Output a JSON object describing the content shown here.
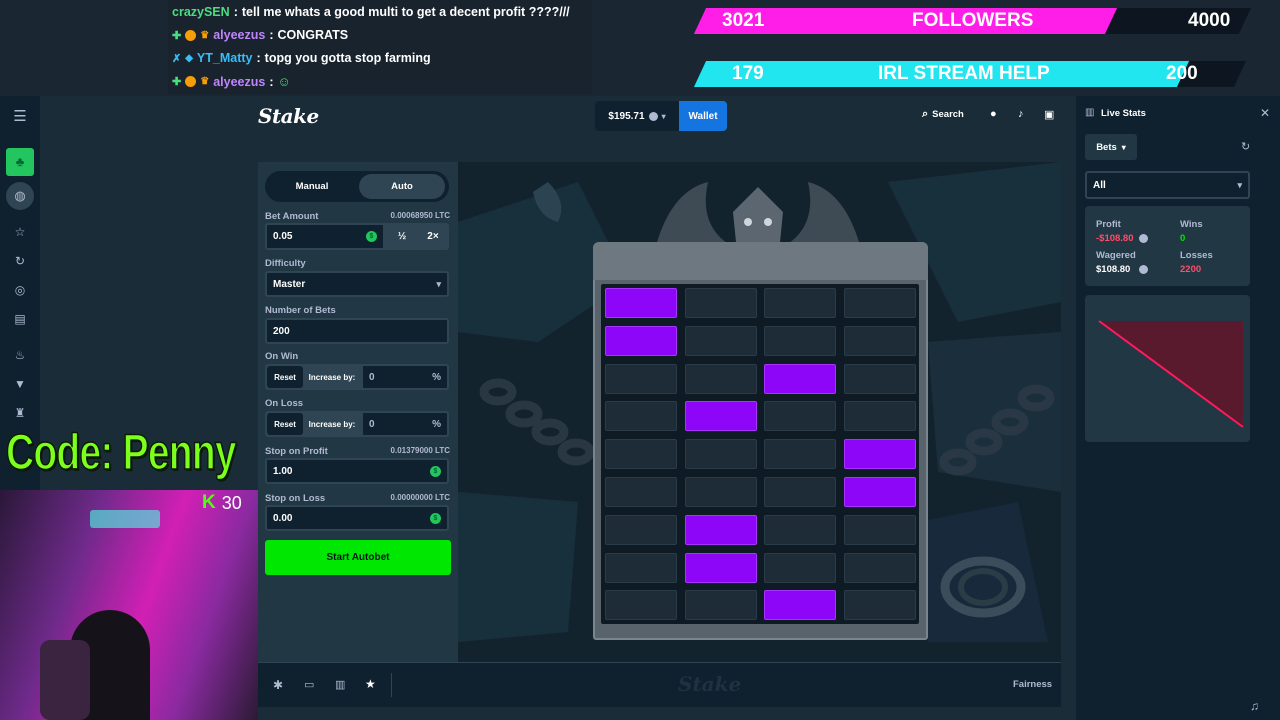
{
  "chat": [
    {
      "user": "crazySEN",
      "user_color": "#4ade80",
      "message": "tell me whats a good multi to get a decent profit ????///"
    },
    {
      "user": "alyeezus",
      "user_color": "#c084fc",
      "message": "CONGRATS"
    },
    {
      "user": "YT_Matty",
      "user_color": "#38bdf8",
      "message": "topg you gotta stop farming"
    },
    {
      "user": "alyeezus",
      "user_color": "#c084fc",
      "message": ""
    }
  ],
  "goals": {
    "followers": {
      "current": "3021",
      "label": "FOLLOWERS",
      "target": "4000",
      "progress": 0.755,
      "color": "#ff1ee8"
    },
    "help": {
      "current": "179",
      "label": "IRL STREAM HELP",
      "target": "200",
      "progress": 0.895,
      "color": "#22e6ef"
    }
  },
  "promo": {
    "code_text": "Code: Penny",
    "kick_count": "30"
  },
  "topbar": {
    "logo": "Stake",
    "balance": "$195.71",
    "wallet_label": "Wallet",
    "search_label": "Search"
  },
  "controls": {
    "tab_manual": "Manual",
    "tab_auto": "Auto",
    "bet_amount_label": "Bet Amount",
    "bet_amount_ltc": "0.00068950 LTC",
    "bet_amount_value": "0.05",
    "half_label": "½",
    "double_label": "2×",
    "difficulty_label": "Difficulty",
    "difficulty_value": "Master",
    "num_bets_label": "Number of Bets",
    "num_bets_value": "200",
    "on_win_label": "On Win",
    "on_loss_label": "On Loss",
    "reset_label": "Reset",
    "increase_label": "Increase by:",
    "on_win_value": "0",
    "on_loss_value": "0",
    "percent": "%",
    "stop_profit_label": "Stop on Profit",
    "stop_profit_ltc": "0.01379000 LTC",
    "stop_profit_value": "1.00",
    "stop_loss_label": "Stop on Loss",
    "stop_loss_ltc": "0.00000000 LTC",
    "stop_loss_value": "0.00",
    "start_label": "Start Autobet"
  },
  "grid": {
    "rows": 9,
    "cols": 4,
    "gems": [
      [
        0,
        0
      ],
      [
        1,
        0
      ],
      [
        2,
        2
      ],
      [
        3,
        1
      ],
      [
        4,
        3
      ],
      [
        5,
        3
      ],
      [
        6,
        1
      ],
      [
        7,
        1
      ],
      [
        8,
        2
      ]
    ]
  },
  "footer": {
    "fairness_label": "Fairness",
    "watermark": "Stake"
  },
  "live_stats": {
    "title": "Live Stats",
    "bets_dropdown": "Bets",
    "filter_value": "All",
    "profit_label": "Profit",
    "profit_value": "-$108.80",
    "wins_label": "Wins",
    "wins_value": "0",
    "wagered_label": "Wagered",
    "wagered_value": "$108.80",
    "losses_label": "Losses",
    "losses_value": "2200"
  }
}
